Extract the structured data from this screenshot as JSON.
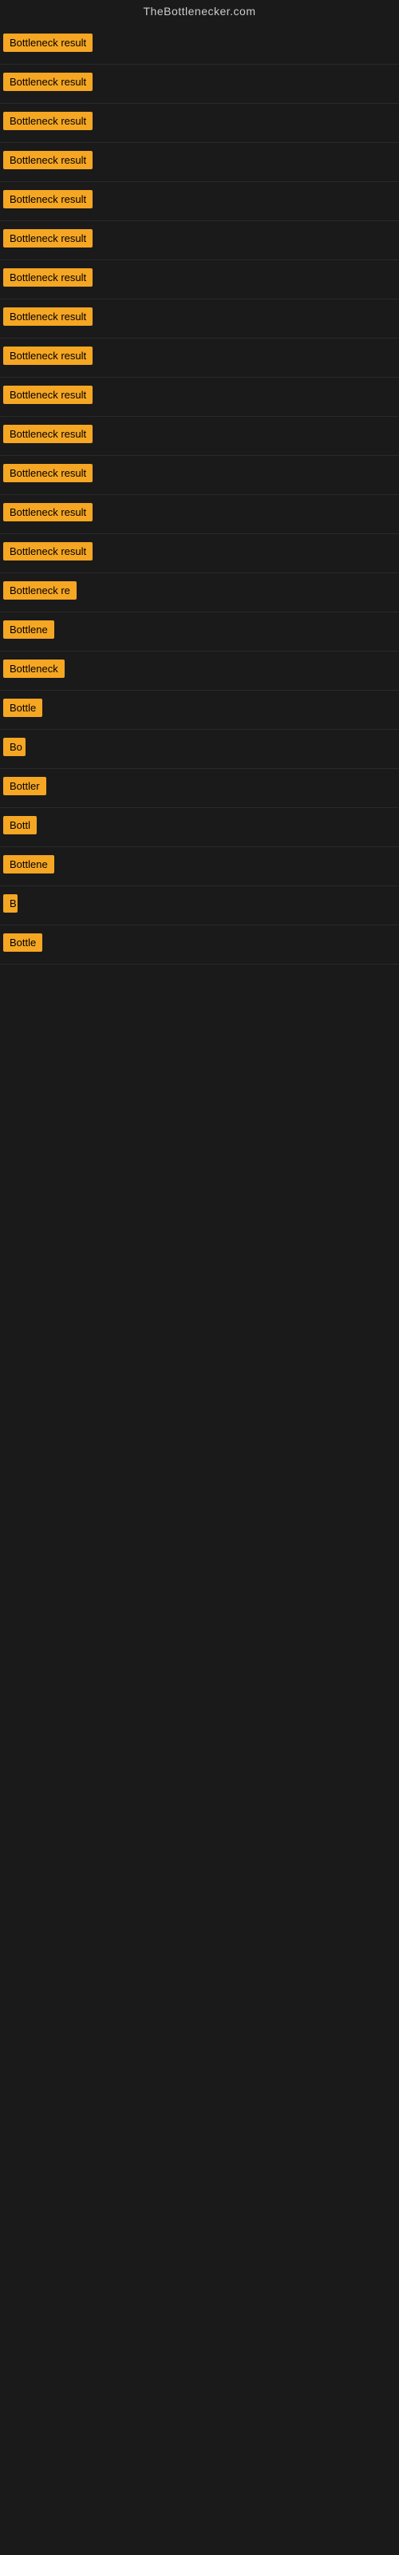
{
  "site": {
    "title": "TheBottlenecker.com"
  },
  "results": [
    {
      "id": 1,
      "label": "Bottleneck result",
      "width": 130
    },
    {
      "id": 2,
      "label": "Bottleneck result",
      "width": 130
    },
    {
      "id": 3,
      "label": "Bottleneck result",
      "width": 130
    },
    {
      "id": 4,
      "label": "Bottleneck result",
      "width": 130
    },
    {
      "id": 5,
      "label": "Bottleneck result",
      "width": 130
    },
    {
      "id": 6,
      "label": "Bottleneck result",
      "width": 130
    },
    {
      "id": 7,
      "label": "Bottleneck result",
      "width": 130
    },
    {
      "id": 8,
      "label": "Bottleneck result",
      "width": 130
    },
    {
      "id": 9,
      "label": "Bottleneck result",
      "width": 130
    },
    {
      "id": 10,
      "label": "Bottleneck result",
      "width": 130
    },
    {
      "id": 11,
      "label": "Bottleneck result",
      "width": 130
    },
    {
      "id": 12,
      "label": "Bottleneck result",
      "width": 118
    },
    {
      "id": 13,
      "label": "Bottleneck result",
      "width": 118
    },
    {
      "id": 14,
      "label": "Bottleneck result",
      "width": 113
    },
    {
      "id": 15,
      "label": "Bottleneck re",
      "width": 95
    },
    {
      "id": 16,
      "label": "Bottlene",
      "width": 74
    },
    {
      "id": 17,
      "label": "Bottleneck",
      "width": 80
    },
    {
      "id": 18,
      "label": "Bottle",
      "width": 58
    },
    {
      "id": 19,
      "label": "Bo",
      "width": 28
    },
    {
      "id": 20,
      "label": "Bottler",
      "width": 60
    },
    {
      "id": 21,
      "label": "Bottl",
      "width": 50
    },
    {
      "id": 22,
      "label": "Bottlene",
      "width": 68
    },
    {
      "id": 23,
      "label": "B",
      "width": 18
    },
    {
      "id": 24,
      "label": "Bottle",
      "width": 56
    }
  ]
}
